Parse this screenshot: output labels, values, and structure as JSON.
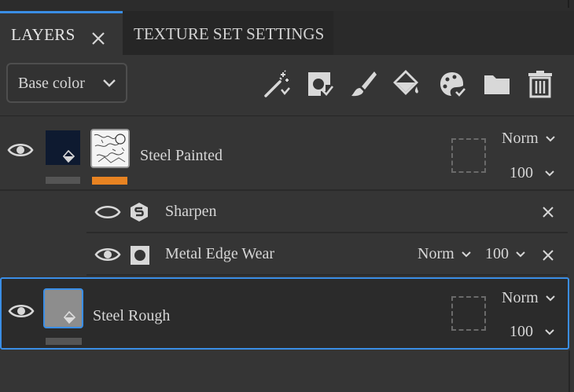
{
  "tabs": {
    "layers_label": "LAYERS",
    "texture_label": "TEXTURE SET SETTINGS"
  },
  "toolbar": {
    "channel_value": "Base color",
    "tools": [
      "add-effect-icon",
      "add-mask-icon",
      "add-paint-layer-icon",
      "add-fill-layer-icon",
      "add-smart-material-icon",
      "add-folder-icon",
      "delete-layer-icon"
    ]
  },
  "layers": [
    {
      "name": "Steel Painted",
      "blend_mode": "Norm",
      "opacity": "100",
      "swatch_color": "#0e1a30",
      "accent_color": "#e88322",
      "effects": [
        {
          "name": "Sharpen",
          "icon": "sharpen-filter-icon"
        },
        {
          "name": "Metal Edge Wear",
          "icon": "generator-icon",
          "blend_mode": "Norm",
          "opacity": "100"
        }
      ]
    },
    {
      "name": "Steel Rough",
      "blend_mode": "Norm",
      "opacity": "100",
      "swatch_color": "#8d8d8d",
      "selected": true
    }
  ],
  "colors": {
    "selection": "#3a8ee6",
    "panel": "#353535"
  }
}
